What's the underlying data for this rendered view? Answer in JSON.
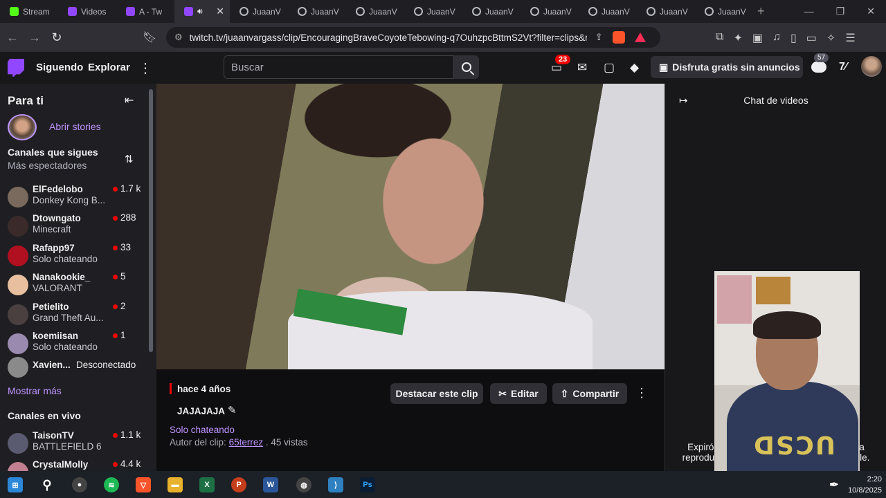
{
  "browser": {
    "tabs": [
      {
        "label": "Stream",
        "icon": "kick-icon"
      },
      {
        "label": "Videos",
        "icon": "twitch-icon"
      },
      {
        "label": "A - Tw",
        "icon": "twitch-icon"
      },
      {
        "label": "",
        "icon": "twitch-icon",
        "active": true
      },
      {
        "label": "JuaanV",
        "icon": "github-icon"
      },
      {
        "label": "JuaanV",
        "icon": "github-icon"
      },
      {
        "label": "JuaanV",
        "icon": "github-icon"
      },
      {
        "label": "JuaanV",
        "icon": "github-icon"
      },
      {
        "label": "JuaanV",
        "icon": "github-icon"
      },
      {
        "label": "JuaanV",
        "icon": "github-icon"
      },
      {
        "label": "JuaanV",
        "icon": "github-icon"
      },
      {
        "label": "JuaanV",
        "icon": "github-icon"
      },
      {
        "label": "JuaanV",
        "icon": "github-icon"
      }
    ],
    "url": "twitch.tv/juaanvargass/clip/EncouragingBraveCoyoteTebowing-q7OuhzpcBttmS2Vt?filter=clips&r..."
  },
  "topnav": {
    "following": "Siguendo",
    "explore": "Explorar",
    "search_placeholder": "Buscar",
    "notifications_count": "23",
    "ad_free": "Disfruta gratis sin anuncios",
    "cloud_count": "57"
  },
  "sidebar": {
    "title": "Para ti",
    "open_stories": "Abrir stories",
    "followed_title": "Canales que sigues",
    "followed_sub": "Más espectadores",
    "channels": [
      {
        "name": "ElFedelobo",
        "game": "Donkey Kong B...",
        "viewers": "1.7 k",
        "color": "#7a6a5e"
      },
      {
        "name": "Dtowngato",
        "game": "Minecraft",
        "viewers": "288",
        "color": "#3a2a2a"
      },
      {
        "name": "Rafapp97",
        "game": "Solo chateando",
        "viewers": "33",
        "color": "#b01020"
      },
      {
        "name": "Nanakookie_",
        "game": "VALORANT",
        "viewers": "5",
        "color": "#e8c0a0"
      },
      {
        "name": "Petielito",
        "game": "Grand Theft Au...",
        "viewers": "2",
        "color": "#4a4040"
      },
      {
        "name": "koemiisan",
        "game": "Solo chateando",
        "viewers": "1",
        "color": "#9a8ab0"
      }
    ],
    "offline_channel": {
      "name": "Xavien...",
      "status": "Desconectado",
      "color": "#8a8a8a"
    },
    "show_more": "Mostrar más",
    "live_title": "Canales en vivo",
    "live_channels": [
      {
        "name": "TaisonTV",
        "game": "BATTLEFIELD 6",
        "viewers": "1.1 k",
        "color": "#5a5a70"
      },
      {
        "name": "CrystalMolly",
        "game": "",
        "viewers": "4.4 k",
        "color": "#c08090"
      }
    ]
  },
  "clip": {
    "ago": "hace 4 años",
    "title": "JAJAJAJA",
    "category": "Solo chateando",
    "author_label": "Autor del clip:",
    "author": "65terrez",
    "views": ". 45 vistas",
    "highlight_btn": "Destacar este clip",
    "edit_btn": "Editar",
    "share_btn": "Compartir"
  },
  "chat": {
    "title": "Chat de videos",
    "expired": "Expiró",
    "expired_tail": "a",
    "repro": "reprodu",
    "repro_tail": "le."
  },
  "taskbar": {
    "time": "2:20",
    "date": "10/8/2025"
  },
  "colors": {
    "accent": "#9147ff",
    "link": "#bf94ff",
    "live": "#eb0400"
  }
}
